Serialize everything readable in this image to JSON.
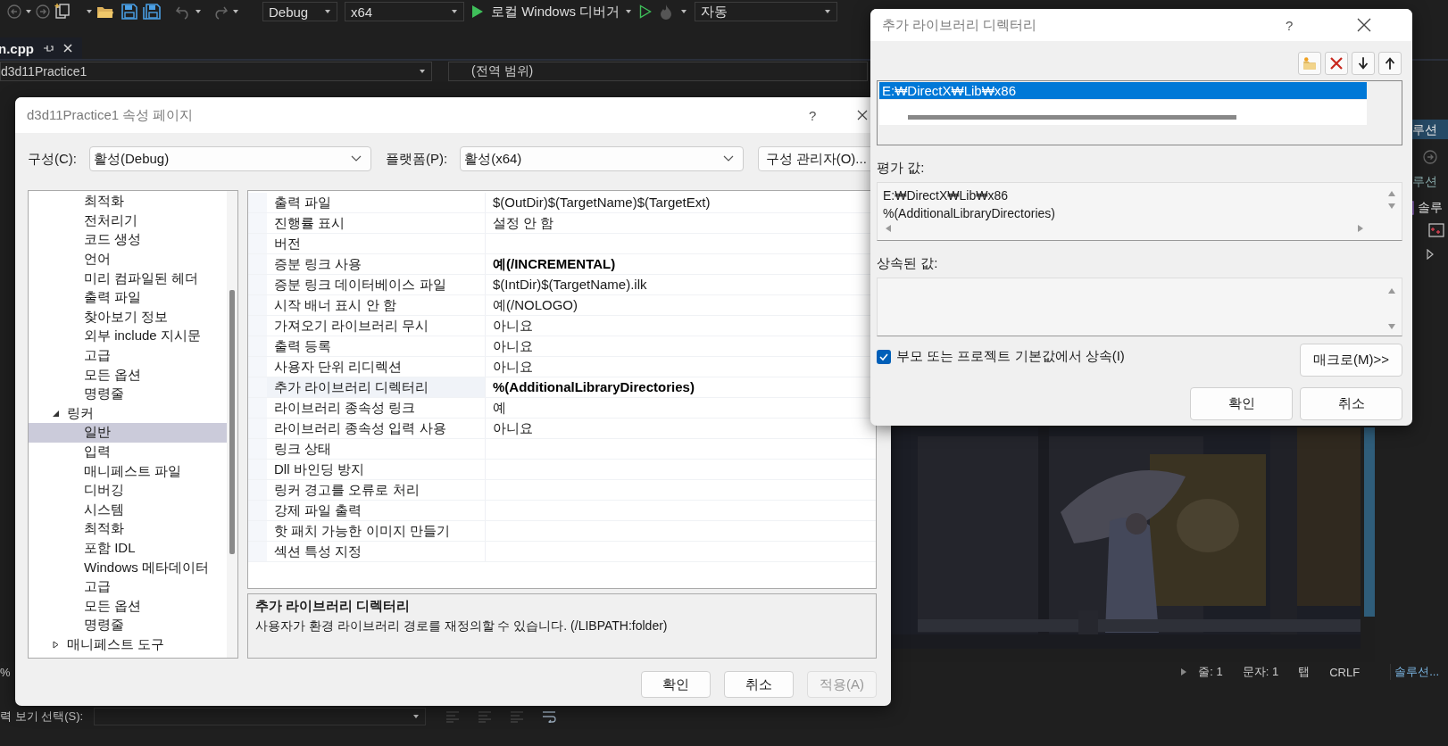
{
  "ide": {
    "toolbar": {
      "configuration": "Debug",
      "platform": "x64",
      "debugger": "로컬 Windows 디버거",
      "run_mode": "자동"
    },
    "tab": {
      "label": "n.cpp"
    },
    "navigation": {
      "project": "d3d11Practice1",
      "scope": "(전역 범위)"
    },
    "solution_explorer": {
      "tab": "루션",
      "search": "루션",
      "solution": "솔루"
    },
    "status_bar": {
      "zoom": "%",
      "line": "줄: 1",
      "column": "문자: 1",
      "indent": "탭",
      "line_ending": "CRLF",
      "panel_tab": "솔루션..."
    },
    "output": {
      "label": "력 보기 선택(S):"
    }
  },
  "property_dialog": {
    "title": "d3d11Practice1 속성 페이지",
    "help": "?",
    "configuration": {
      "label": "구성(C):",
      "value": "활성(Debug)"
    },
    "platform": {
      "label": "플랫폼(P):",
      "value": "활성(x64)"
    },
    "manager_button": "구성 관리자(O)...",
    "tree": [
      {
        "kind": "continuation",
        "children": [
          {
            "label": "최적화",
            "selected": false
          },
          {
            "label": "전처리기",
            "selected": false
          },
          {
            "label": "코드 생성",
            "selected": false
          },
          {
            "label": "언어",
            "selected": false
          },
          {
            "label": "미리 컴파일된 헤더",
            "selected": false
          },
          {
            "label": "출력 파일",
            "selected": false
          },
          {
            "label": "찾아보기 정보",
            "selected": false
          },
          {
            "label": "외부 include 지시문",
            "selected": false
          },
          {
            "label": "고급",
            "selected": false
          },
          {
            "label": "모든 옵션",
            "selected": false
          },
          {
            "label": "명령줄",
            "selected": false
          }
        ]
      },
      {
        "kind": "node",
        "label": "링커",
        "expanded": true,
        "selected": false,
        "children": [
          {
            "label": "일반",
            "selected": true
          },
          {
            "label": "입력",
            "selected": false
          },
          {
            "label": "매니페스트 파일",
            "selected": false
          },
          {
            "label": "디버깅",
            "selected": false
          },
          {
            "label": "시스템",
            "selected": false
          },
          {
            "label": "최적화",
            "selected": false
          },
          {
            "label": "포함 IDL",
            "selected": false
          },
          {
            "label": "Windows 메타데이터",
            "selected": false
          },
          {
            "label": "고급",
            "selected": false
          },
          {
            "label": "모든 옵션",
            "selected": false
          },
          {
            "label": "명령줄",
            "selected": false
          }
        ]
      },
      {
        "kind": "node",
        "label": "매니페스트 도구",
        "expanded": false,
        "selected": false
      }
    ],
    "properties": [
      {
        "name": "출력 파일",
        "value": "$(OutDir)$(TargetName)$(TargetExt)",
        "modified": false,
        "selected": false
      },
      {
        "name": "진행률 표시",
        "value": "설정 안 함",
        "modified": false,
        "selected": false
      },
      {
        "name": "버전",
        "selected": false
      },
      {
        "name": "증분 링크 사용",
        "value": "예(/INCREMENTAL)",
        "modified": true,
        "selected": false
      },
      {
        "name": "증분 링크 데이터베이스 파일",
        "value": "$(IntDir)$(TargetName).ilk",
        "modified": false,
        "selected": false
      },
      {
        "name": "시작 배너 표시 안 함",
        "value": "예(/NOLOGO)",
        "modified": false,
        "selected": false
      },
      {
        "name": "가져오기 라이브러리 무시",
        "value": "아니요",
        "modified": false,
        "selected": false
      },
      {
        "name": "출력 등록",
        "value": "아니요",
        "modified": false,
        "selected": false
      },
      {
        "name": "사용자 단위 리디렉션",
        "value": "아니요",
        "modified": false,
        "selected": false
      },
      {
        "name": "추가 라이브러리 디렉터리",
        "value": "%(AdditionalLibraryDirectories)",
        "modified": true,
        "selected": true
      },
      {
        "name": "라이브러리 종속성 링크",
        "value": "예",
        "modified": false,
        "selected": false
      },
      {
        "name": "라이브러리 종속성 입력 사용",
        "value": "아니요",
        "modified": false,
        "selected": false
      },
      {
        "name": "링크 상태",
        "selected": false
      },
      {
        "name": "Dll 바인딩 방지",
        "selected": false
      },
      {
        "name": "링커 경고를 오류로 처리",
        "selected": false
      },
      {
        "name": "강제 파일 출력",
        "selected": false
      },
      {
        "name": "핫 패치 가능한 이미지 만들기",
        "selected": false
      },
      {
        "name": "섹션 특성 지정",
        "selected": false
      }
    ],
    "description": {
      "title": "추가 라이브러리 디렉터리",
      "text": "사용자가 환경 라이브러리 경로를 재정의할 수 있습니다. (/LIBPATH:folder)"
    },
    "buttons": [
      {
        "label": "확인",
        "disabled": false
      },
      {
        "label": "취소",
        "disabled": false
      },
      {
        "label": "적용(A)",
        "disabled": true
      }
    ]
  },
  "library_dialog": {
    "title": "추가 라이브러리 디렉터리",
    "help": "?",
    "entries": [
      {
        "text": "E:₩DirectX₩Lib₩x86",
        "selected": true
      }
    ],
    "evaluated": {
      "label": "평가 값:",
      "lines": [
        "E:₩DirectX₩Lib₩x86",
        "%(AdditionalLibraryDirectories)"
      ]
    },
    "inherited": {
      "label": "상속된 값:"
    },
    "inherit_checkbox": {
      "label": "부모 또는 프로젝트 기본값에서 상속(I)",
      "checked": true
    },
    "macro_button": "매크로(M)>>",
    "buttons": [
      {
        "label": "확인"
      },
      {
        "label": "취소"
      }
    ]
  }
}
